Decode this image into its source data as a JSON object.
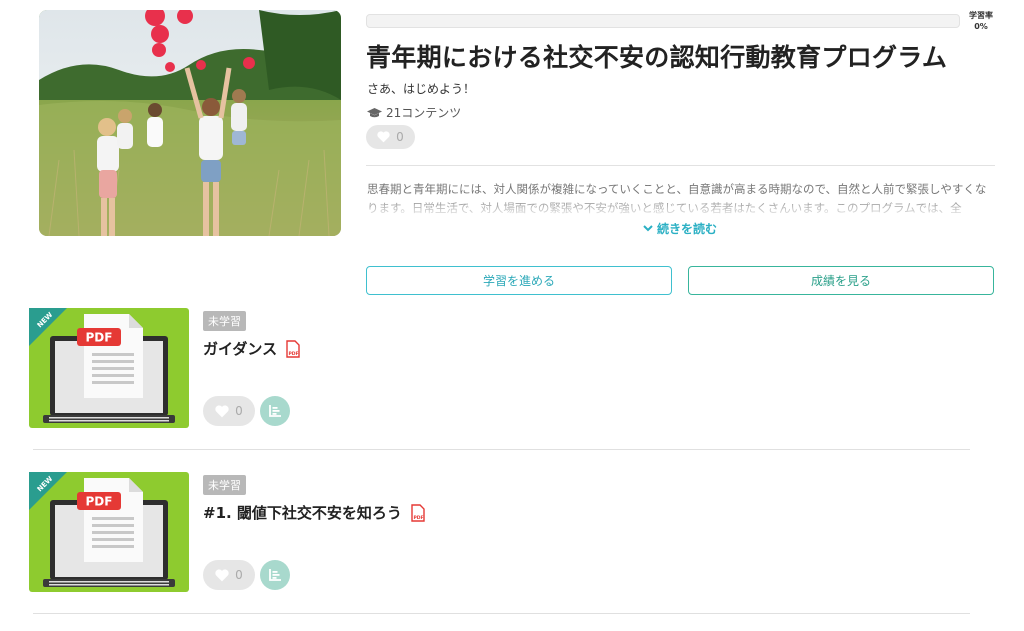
{
  "course": {
    "progress": {
      "label": "学習率",
      "percent_text": "0%",
      "value": 0
    },
    "title": "青年期における社交不安の認知行動教育プログラム",
    "subtitle": "さあ、はじめよう！",
    "content_count": "21コンテンツ",
    "likes": "0",
    "description": "思春期と青年期にには、対人関係が複雑になっていくことと、自意識が高まる時期なので、自然と人前で緊張しやすくなります。日常生活で、対人場面での緊張や不安が強いと感じている若者はたくさんいます。このプログラムでは、全",
    "read_more": "続きを読む",
    "buttons": {
      "progress": "学習を進める",
      "results": "成績を見る"
    }
  },
  "items": [
    {
      "badge": "未学習",
      "title": "ガイダンス",
      "likes": "0",
      "ribbon": "NEW",
      "thumb_label": "PDF"
    },
    {
      "badge": "未学習",
      "title": "#1. 閾値下社交不安を知ろう",
      "likes": "0",
      "ribbon": "NEW",
      "thumb_label": "PDF"
    }
  ],
  "colors": {
    "accent_teal": "#34b7a7",
    "accent_cyan": "#3fc0cf",
    "thumb_green": "#8ecb2f",
    "ribbon": "#2a9d8f",
    "pdf_red": "#e53935"
  },
  "icons": {
    "cap": "graduation-cap-icon",
    "heart": "heart-icon",
    "chevron": "chevron-down-icon",
    "stats": "chart-icon",
    "pdf": "pdf-file-icon"
  }
}
